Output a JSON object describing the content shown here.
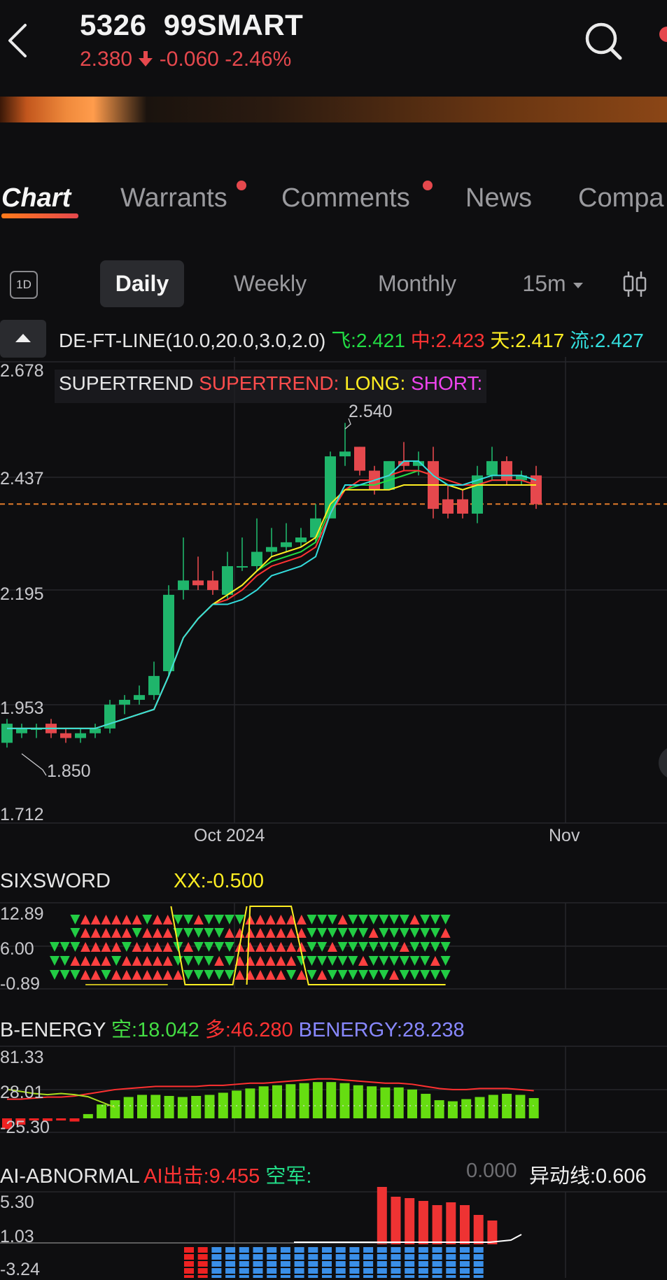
{
  "header": {
    "code": "5326",
    "name": "99SMART",
    "price": "2.380",
    "change": "-0.060",
    "change_pct": "-2.46%",
    "direction_icon": "arrow-down-icon",
    "colors": {
      "down": "#e5484d",
      "up": "#1fb56b"
    }
  },
  "tabs": [
    {
      "label": "Chart",
      "active": true,
      "dot": false
    },
    {
      "label": "Warrants",
      "active": false,
      "dot": true
    },
    {
      "label": "Comments",
      "active": false,
      "dot": true
    },
    {
      "label": "News",
      "active": false,
      "dot": false
    },
    {
      "label": "Compa",
      "active": false,
      "dot": false
    }
  ],
  "periods": {
    "one_day_icon": "1D",
    "items": [
      "Daily",
      "Weekly",
      "Monthly",
      "15m"
    ],
    "active": "Daily",
    "candle_icon": "candlestick-icon"
  },
  "indicator": {
    "main": "DE-FT-LINE(10.0,20.0,3.0,2.0)",
    "fei": "飞:2.421",
    "zhong": "中:2.423",
    "tian": "天:2.417",
    "liu": "流:2.427",
    "supertrend_a": "SUPERTREND",
    "supertrend_b": "SUPERTREND:",
    "long": "LONG:",
    "short": "SHORT:"
  },
  "chart_data": {
    "type": "candlestick",
    "y_ticks": [
      "2.678",
      "2.437",
      "2.195",
      "1.953",
      "1.712"
    ],
    "ylim": [
      1.712,
      2.678
    ],
    "x_labels": [
      "Oct 2024",
      "Nov"
    ],
    "high_label": "2.540",
    "low_label": "1.850",
    "last_price_line": 2.38,
    "candles": [
      [
        1.88,
        1.92,
        1.87,
        1.93
      ],
      [
        1.9,
        1.91,
        1.89,
        1.92
      ],
      [
        1.91,
        1.91,
        1.89,
        1.92
      ],
      [
        1.92,
        1.9,
        1.89,
        1.93
      ],
      [
        1.9,
        1.89,
        1.88,
        1.91
      ],
      [
        1.89,
        1.9,
        1.88,
        1.91
      ],
      [
        1.9,
        1.91,
        1.89,
        1.92
      ],
      [
        1.91,
        1.96,
        1.9,
        1.97
      ],
      [
        1.96,
        1.97,
        1.94,
        1.98
      ],
      [
        1.97,
        1.98,
        1.96,
        2.0
      ],
      [
        1.98,
        2.02,
        1.97,
        2.05
      ],
      [
        2.03,
        2.19,
        2.02,
        2.21
      ],
      [
        2.2,
        2.22,
        2.18,
        2.31
      ],
      [
        2.22,
        2.21,
        2.2,
        2.27
      ],
      [
        2.22,
        2.2,
        2.19,
        2.24
      ],
      [
        2.19,
        2.25,
        2.18,
        2.28
      ],
      [
        2.25,
        2.25,
        2.24,
        2.31
      ],
      [
        2.25,
        2.28,
        2.24,
        2.35
      ],
      [
        2.28,
        2.29,
        2.27,
        2.33
      ],
      [
        2.29,
        2.3,
        2.28,
        2.34
      ],
      [
        2.3,
        2.31,
        2.29,
        2.33
      ],
      [
        2.31,
        2.35,
        2.3,
        2.38
      ],
      [
        2.35,
        2.48,
        2.35,
        2.49
      ],
      [
        2.48,
        2.49,
        2.46,
        2.55
      ],
      [
        2.5,
        2.45,
        2.44,
        2.5
      ],
      [
        2.45,
        2.41,
        2.4,
        2.46
      ],
      [
        2.41,
        2.47,
        2.41,
        2.47
      ],
      [
        2.47,
        2.46,
        2.45,
        2.51
      ],
      [
        2.46,
        2.47,
        2.44,
        2.49
      ],
      [
        2.47,
        2.37,
        2.35,
        2.5
      ],
      [
        2.39,
        2.36,
        2.35,
        2.42
      ],
      [
        2.39,
        2.36,
        2.35,
        2.41
      ],
      [
        2.36,
        2.44,
        2.34,
        2.46
      ],
      [
        2.44,
        2.47,
        2.43,
        2.5
      ],
      [
        2.47,
        2.43,
        2.42,
        2.48
      ],
      [
        2.43,
        2.44,
        2.42,
        2.45
      ],
      [
        2.44,
        2.38,
        2.37,
        2.46
      ]
    ],
    "lines": {
      "fei": [
        1.91,
        1.91,
        1.91,
        1.91,
        1.91,
        1.91,
        1.91,
        1.92,
        1.93,
        1.94,
        1.95,
        2.02,
        2.1,
        2.14,
        2.17,
        2.19,
        2.21,
        2.24,
        2.26,
        2.27,
        2.28,
        2.3,
        2.37,
        2.41,
        2.42,
        2.42,
        2.43,
        2.44,
        2.45,
        2.44,
        2.42,
        2.41,
        2.42,
        2.43,
        2.43,
        2.43,
        2.42
      ],
      "zhong": [
        1.91,
        1.91,
        1.91,
        1.91,
        1.91,
        1.91,
        1.91,
        1.92,
        1.93,
        1.94,
        1.95,
        2.02,
        2.1,
        2.14,
        2.17,
        2.18,
        2.2,
        2.23,
        2.25,
        2.26,
        2.27,
        2.29,
        2.36,
        2.41,
        2.43,
        2.43,
        2.44,
        2.45,
        2.45,
        2.44,
        2.43,
        2.42,
        2.42,
        2.43,
        2.43,
        2.43,
        2.42
      ],
      "tian": [
        1.91,
        1.91,
        1.91,
        1.91,
        1.91,
        1.91,
        1.91,
        1.92,
        1.93,
        1.94,
        1.95,
        2.02,
        2.1,
        2.14,
        2.17,
        2.19,
        2.21,
        2.24,
        2.27,
        2.28,
        2.29,
        2.31,
        2.38,
        2.41,
        2.41,
        2.41,
        2.41,
        2.42,
        2.42,
        2.42,
        2.42,
        2.41,
        2.42,
        2.42,
        2.42,
        2.42,
        2.42
      ],
      "liu": [
        1.91,
        1.91,
        1.91,
        1.91,
        1.91,
        1.91,
        1.91,
        1.92,
        1.93,
        1.94,
        1.95,
        2.02,
        2.1,
        2.14,
        2.17,
        2.17,
        2.18,
        2.2,
        2.23,
        2.24,
        2.25,
        2.27,
        2.36,
        2.42,
        2.42,
        2.43,
        2.44,
        2.47,
        2.47,
        2.44,
        2.42,
        2.42,
        2.43,
        2.44,
        2.44,
        2.44,
        2.43
      ]
    },
    "line_colors": {
      "fei": "#22dd44",
      "zhong": "#ff3333",
      "tian": "#ffee22",
      "liu": "#33dddd"
    }
  },
  "sixsword": {
    "title": "SIXSWORD",
    "xx": "XX:-0.500",
    "y_ticks": [
      "12.89",
      "6.00",
      "-0.89"
    ],
    "signals": "GGGRRRRRRRRRGGGGGGRRRRRRRGGGGGGGGGGGGGG"
  },
  "benergy": {
    "title": "B-ENERGY",
    "kong": "空:18.042",
    "duo": "多:46.280",
    "benergy": "BENERGY:28.238",
    "y_ticks": [
      "81.33",
      "28.01",
      "-25.30"
    ],
    "bars": [
      -20,
      -12,
      -4,
      -5,
      -4,
      -6,
      8,
      26,
      34,
      40,
      44,
      44,
      42,
      40,
      42,
      44,
      48,
      52,
      56,
      60,
      62,
      64,
      66,
      68,
      68,
      66,
      62,
      60,
      58,
      58,
      54,
      46,
      34,
      32,
      36,
      40,
      44,
      46,
      44,
      38
    ]
  },
  "abnormal": {
    "title": "AI-ABNORMAL",
    "ai": "AI出击:9.455",
    "kongjun": "空军:",
    "zero": "0.000",
    "yidong": "异动线:0.606",
    "y_ticks": [
      "5.30",
      "1.03",
      "-3.24"
    ]
  }
}
